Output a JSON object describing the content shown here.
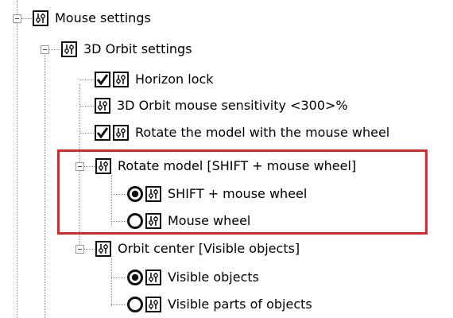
{
  "colors": {
    "highlight_border": "#e02525",
    "tree_line": "#8a8a8a",
    "icon_ink": "#111111"
  },
  "tree": {
    "mouse_settings": {
      "label": "Mouse settings",
      "expanded": true,
      "icon": "settings-slider-icon"
    },
    "orbit_settings": {
      "label": "3D Orbit settings",
      "expanded": true,
      "icon": "settings-slider-icon"
    },
    "horizon_lock": {
      "label": "Horizon lock",
      "checked": true,
      "icon": "settings-slider-icon"
    },
    "sensitivity": {
      "label": "3D Orbit mouse sensitivity <300>%",
      "icon": "settings-slider-icon"
    },
    "rotate_wheel": {
      "label": "Rotate the model with the mouse wheel",
      "checked": true,
      "icon": "settings-slider-icon"
    },
    "rotate_model": {
      "label": "Rotate model [SHIFT + mouse wheel]",
      "expanded": true,
      "icon": "settings-slider-icon",
      "options": [
        {
          "label": "SHIFT + mouse wheel",
          "selected": true
        },
        {
          "label": "Mouse wheel",
          "selected": false
        }
      ]
    },
    "orbit_center": {
      "label": "Orbit center [Visible objects]",
      "expanded": true,
      "icon": "settings-slider-icon",
      "options": [
        {
          "label": "Visible objects",
          "selected": true
        },
        {
          "label": "Visible parts of objects",
          "selected": false
        }
      ]
    }
  }
}
